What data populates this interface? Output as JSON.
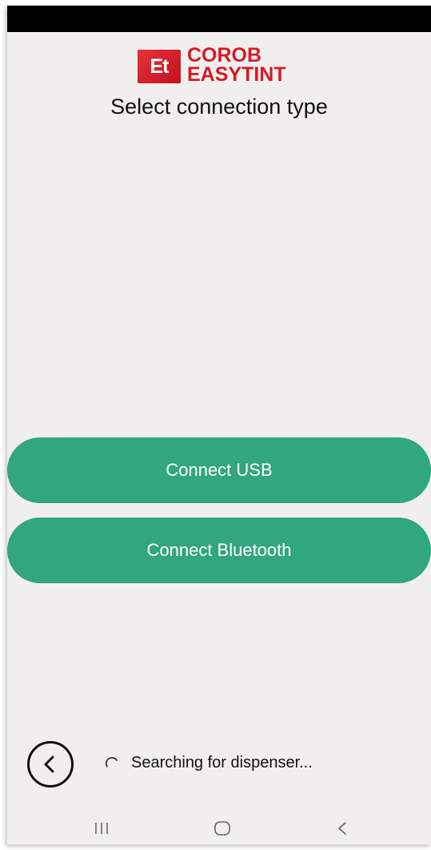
{
  "brand": {
    "mark": "Et",
    "name_line1": "COROB",
    "name_line2": "EASYTINT"
  },
  "title": "Select connection type",
  "buttons": {
    "usb_label": "Connect USB",
    "bluetooth_label": "Connect Bluetooth"
  },
  "status": {
    "text": "Searching for dispenser..."
  },
  "icons": {
    "back": "back-arrow-circle-icon",
    "spinner": "loading-spinner-icon",
    "recents": "recents-icon",
    "home": "home-icon",
    "nav_back": "nav-back-icon"
  },
  "colors": {
    "accent": "#32a67d",
    "brand_red": "#d41b26",
    "background": "#f1efee"
  }
}
